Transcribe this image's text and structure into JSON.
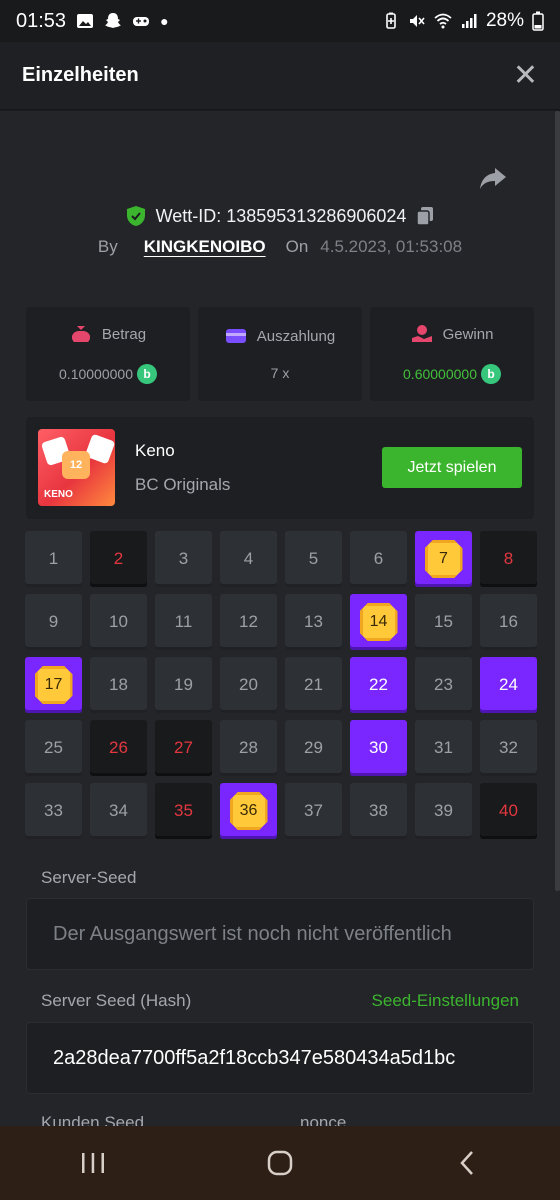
{
  "status_bar": {
    "time": "01:53",
    "battery": "28%"
  },
  "header": {
    "title": "Einzelheiten"
  },
  "bet": {
    "id_label": "Wett-ID: 138595313286906024",
    "by_label": "By",
    "user": "KINGKENOIBO",
    "on_label": "On",
    "date": "4.5.2023, 01:53:08"
  },
  "stats": {
    "amount": {
      "label": "Betrag",
      "value": "0.10000000"
    },
    "payout": {
      "label": "Auszahlung",
      "value": "7 x"
    },
    "profit": {
      "label": "Gewinn",
      "value": "0.60000000"
    }
  },
  "game": {
    "name": "Keno",
    "provider": "BC Originals",
    "play_label": "Jetzt spielen",
    "thumb_label": "KENO",
    "thumb_number": "12"
  },
  "grid": {
    "cells": [
      {
        "n": "1",
        "s": "normal"
      },
      {
        "n": "2",
        "s": "miss"
      },
      {
        "n": "3",
        "s": "normal"
      },
      {
        "n": "4",
        "s": "normal"
      },
      {
        "n": "5",
        "s": "normal"
      },
      {
        "n": "6",
        "s": "normal"
      },
      {
        "n": "7",
        "s": "hit"
      },
      {
        "n": "8",
        "s": "miss"
      },
      {
        "n": "9",
        "s": "normal"
      },
      {
        "n": "10",
        "s": "normal"
      },
      {
        "n": "11",
        "s": "normal"
      },
      {
        "n": "12",
        "s": "normal"
      },
      {
        "n": "13",
        "s": "normal"
      },
      {
        "n": "14",
        "s": "hit"
      },
      {
        "n": "15",
        "s": "normal"
      },
      {
        "n": "16",
        "s": "normal"
      },
      {
        "n": "17",
        "s": "hit"
      },
      {
        "n": "18",
        "s": "normal"
      },
      {
        "n": "19",
        "s": "normal"
      },
      {
        "n": "20",
        "s": "normal"
      },
      {
        "n": "21",
        "s": "normal"
      },
      {
        "n": "22",
        "s": "pick"
      },
      {
        "n": "23",
        "s": "normal"
      },
      {
        "n": "24",
        "s": "pick"
      },
      {
        "n": "25",
        "s": "normal"
      },
      {
        "n": "26",
        "s": "miss"
      },
      {
        "n": "27",
        "s": "miss"
      },
      {
        "n": "28",
        "s": "normal"
      },
      {
        "n": "29",
        "s": "normal"
      },
      {
        "n": "30",
        "s": "pick"
      },
      {
        "n": "31",
        "s": "normal"
      },
      {
        "n": "32",
        "s": "normal"
      },
      {
        "n": "33",
        "s": "normal"
      },
      {
        "n": "34",
        "s": "normal"
      },
      {
        "n": "35",
        "s": "miss"
      },
      {
        "n": "36",
        "s": "hit"
      },
      {
        "n": "37",
        "s": "normal"
      },
      {
        "n": "38",
        "s": "normal"
      },
      {
        "n": "39",
        "s": "normal"
      },
      {
        "n": "40",
        "s": "miss"
      }
    ]
  },
  "seeds": {
    "server_seed_label": "Server-Seed",
    "server_seed_value": "Der Ausgangswert ist noch nicht veröffentlich",
    "server_hash_label": "Server Seed (Hash)",
    "seed_settings_label": "Seed-Einstellungen",
    "server_hash_value": "2a28dea7700ff5a2f18ccb347e580434a5d1bc",
    "client_seed_label": "Kunden Seed",
    "nonce_label": "nonce"
  },
  "colors": {
    "accent": "#3cb52e",
    "pick": "#7a26ff",
    "miss": "#e3373f",
    "gem": "#ffc93a"
  }
}
